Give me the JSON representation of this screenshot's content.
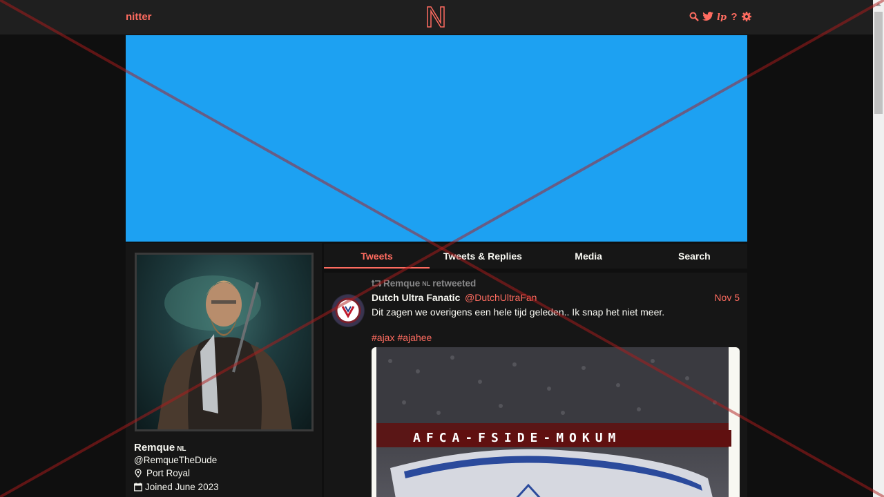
{
  "navbar": {
    "brand": "nitter",
    "logo_letter": "N",
    "icons": [
      "search-icon",
      "twitter-bird-icon",
      "rss-icon",
      "help-icon",
      "settings-icon"
    ],
    "help_glyph": "?"
  },
  "colors": {
    "accent": "#ff6c60",
    "banner": "#1da1f2",
    "background": "#0f0f0f",
    "panel": "#161616",
    "navbar": "#1f1f1f"
  },
  "profile": {
    "fullname": "Remque",
    "flag": "NL",
    "username": "@RemqueTheDude",
    "location": "Port Royal",
    "joined": "Joined June 2023"
  },
  "tabs": [
    {
      "label": "Tweets",
      "active": true
    },
    {
      "label": "Tweets & Replies",
      "active": false
    },
    {
      "label": "Media",
      "active": false
    },
    {
      "label": "Search",
      "active": false
    }
  ],
  "tweet": {
    "retweet_by": "Remque",
    "retweet_flag": "NL",
    "retweet_suffix": "retweeted",
    "fullname": "Dutch Ultra Fanatic",
    "username": "@DutchUltraFan",
    "date": "Nov 5",
    "text": "Dit zagen we overigens een hele tijd geleden.. Ik snap het niet meer.",
    "hashtags": [
      "#ajax",
      "#ajahee"
    ],
    "image_banner_text": "AFCA-FSIDE-MOKUM"
  }
}
